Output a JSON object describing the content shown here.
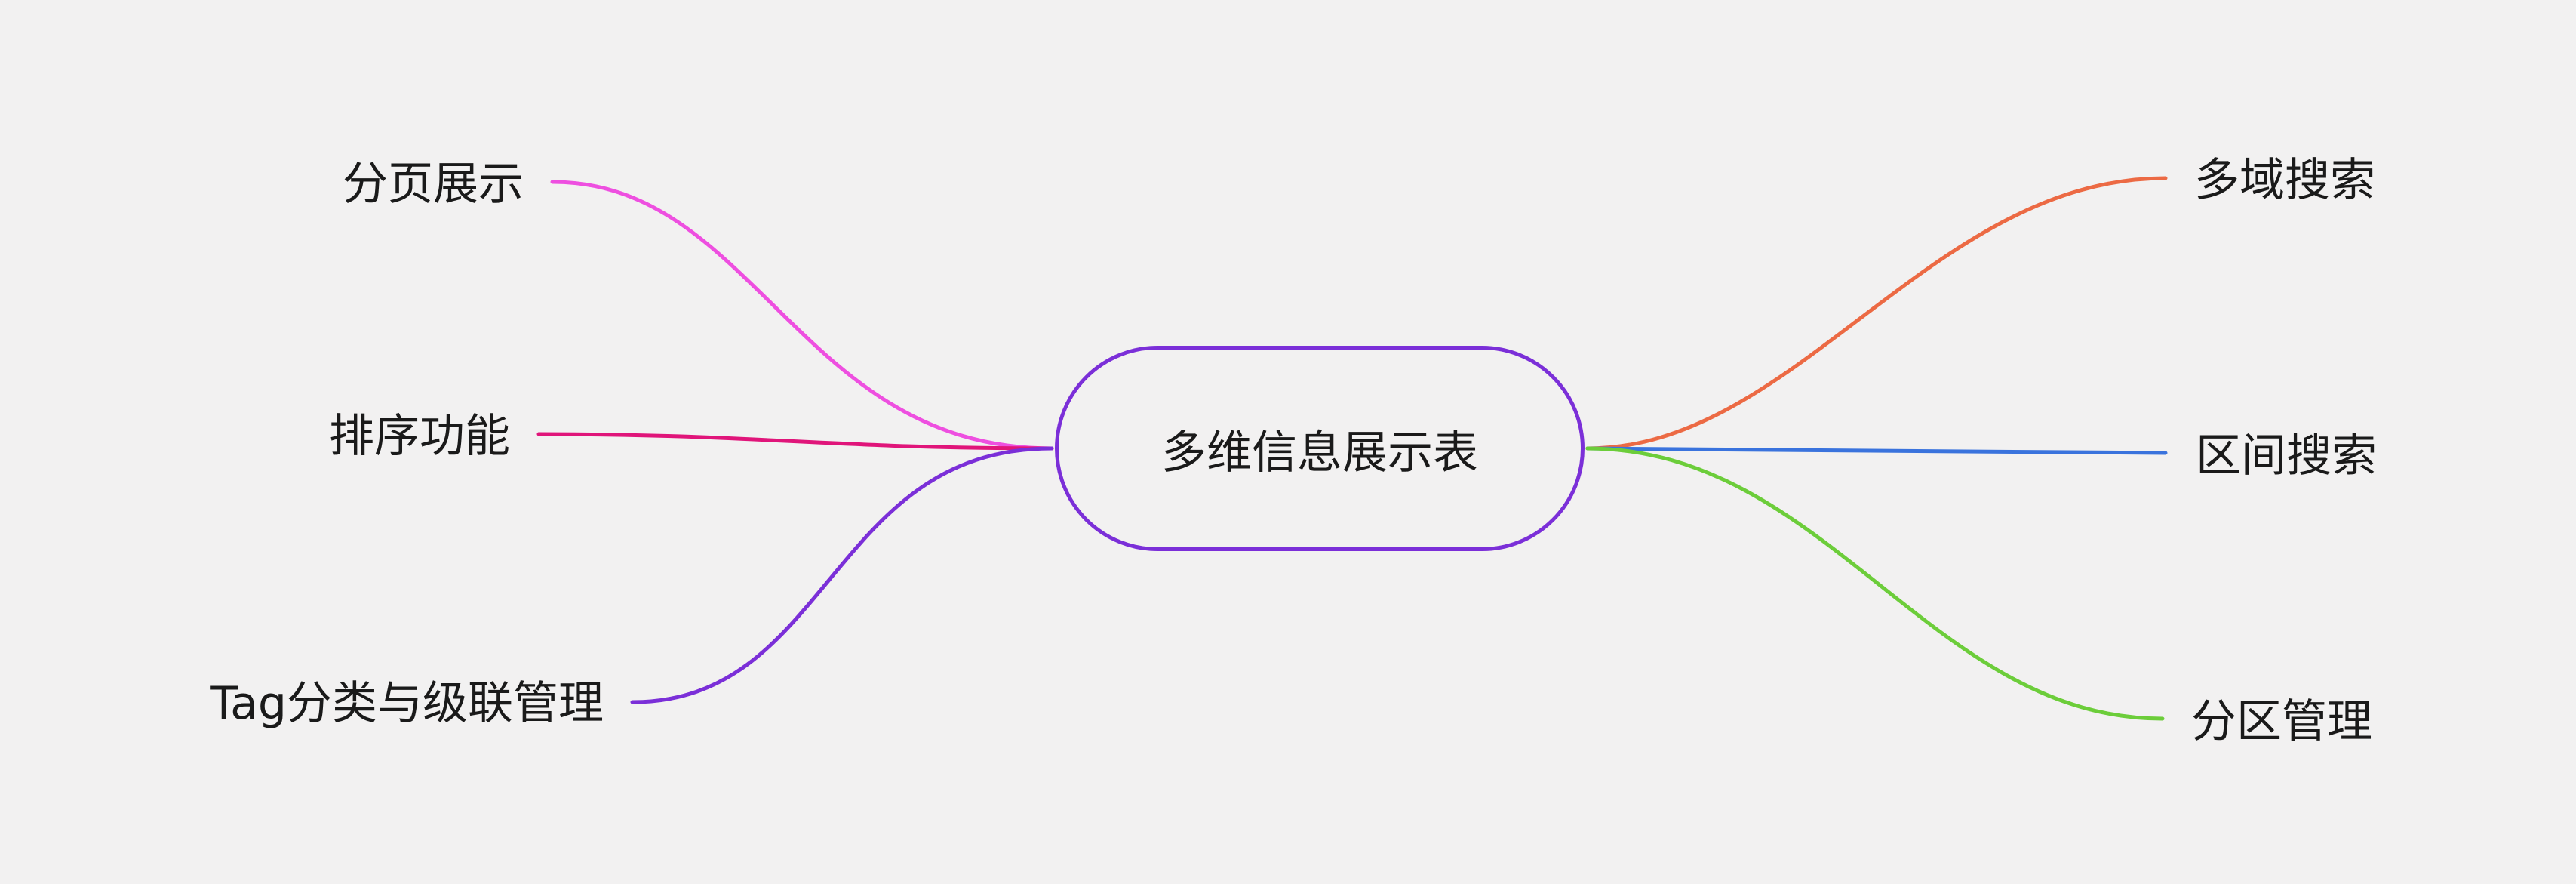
{
  "mindmap": {
    "root": {
      "label": "多维信息展示表",
      "color": "#7b2fd8"
    },
    "right_branches": [
      {
        "label": "多域搜索",
        "color": "#ec6a44"
      },
      {
        "label": "区间搜索",
        "color": "#3a73dd"
      },
      {
        "label": "分区管理",
        "color": "#6ccd3a"
      }
    ],
    "left_branches": [
      {
        "label": "分页展示",
        "color": "#ee4fe0"
      },
      {
        "label": "排序功能",
        "color": "#e0157a"
      },
      {
        "label": "Tag分类与级联管理",
        "color": "#7b2fd8"
      }
    ]
  }
}
